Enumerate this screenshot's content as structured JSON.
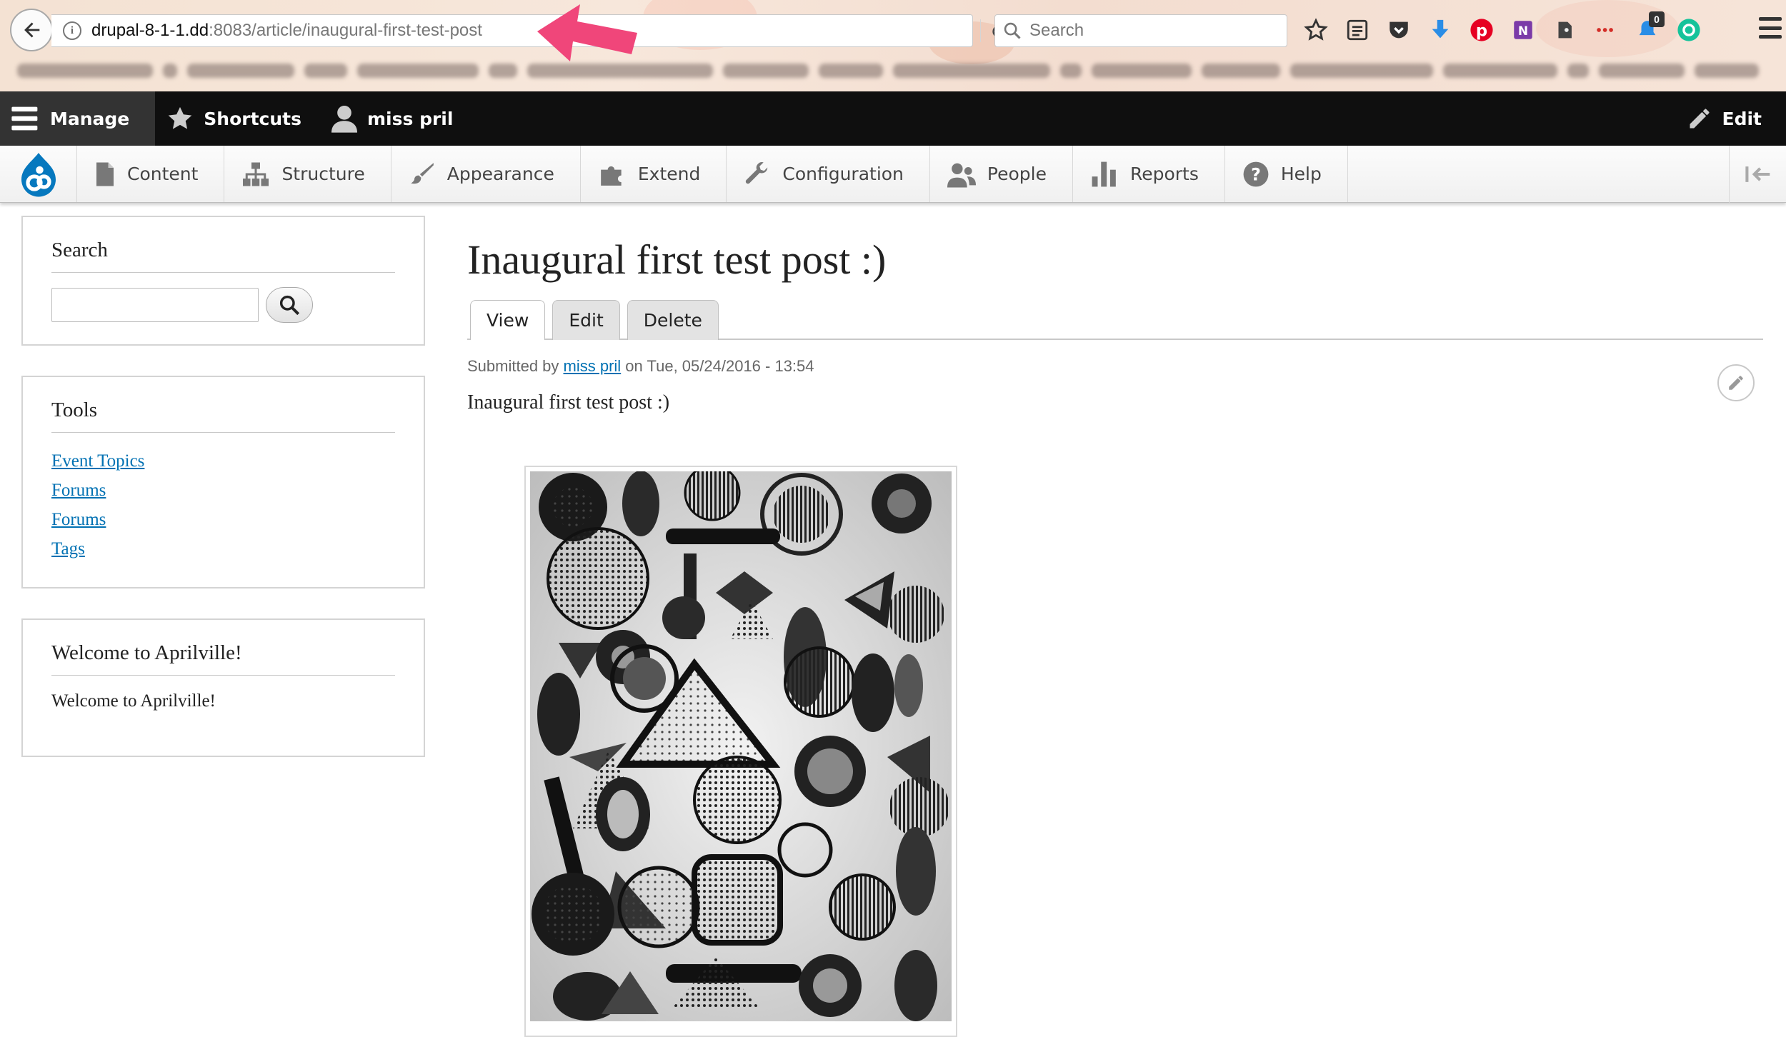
{
  "browser": {
    "url_host": "drupal-8-1-1.dd",
    "url_path": ":8083/article/inaugural-first-test-post",
    "search_placeholder": "Search",
    "badge_count": "0",
    "toolbar_icons": [
      "bookmark-star-icon",
      "reading-list-icon",
      "pocket-icon",
      "download-icon",
      "pinterest-icon",
      "onenote-icon",
      "evernote-icon",
      "lastpass-icon",
      "notification-icon",
      "grammarly-icon"
    ],
    "colors": {
      "annotation_arrow": "#f0467a"
    }
  },
  "admin_toolbar": {
    "manage": "Manage",
    "shortcuts": "Shortcuts",
    "user": "miss pril",
    "edit": "Edit"
  },
  "admin_tray": {
    "items": [
      "Content",
      "Structure",
      "Appearance",
      "Extend",
      "Configuration",
      "People",
      "Reports",
      "Help"
    ]
  },
  "sidebar": {
    "search": {
      "title": "Search",
      "value": ""
    },
    "tools": {
      "title": "Tools",
      "links": [
        "Event Topics",
        "Forums",
        "Forums",
        "Tags"
      ]
    },
    "welcome": {
      "title": "Welcome to Aprilville!",
      "body": "Welcome to Aprilville!"
    }
  },
  "article": {
    "title": "Inaugural first test post :)",
    "tabs": [
      "View",
      "Edit",
      "Delete"
    ],
    "active_tab": "View",
    "submitted_prefix": "Submitted by ",
    "author": "miss pril",
    "submitted_suffix": " on Tue, 05/24/2016 - 13:54",
    "body": "Inaugural first test post :)"
  },
  "theme": {
    "link_color": "#0071b3",
    "admin_bar_bg": "#0f0f0f",
    "drupal_blue": "#0678be"
  }
}
